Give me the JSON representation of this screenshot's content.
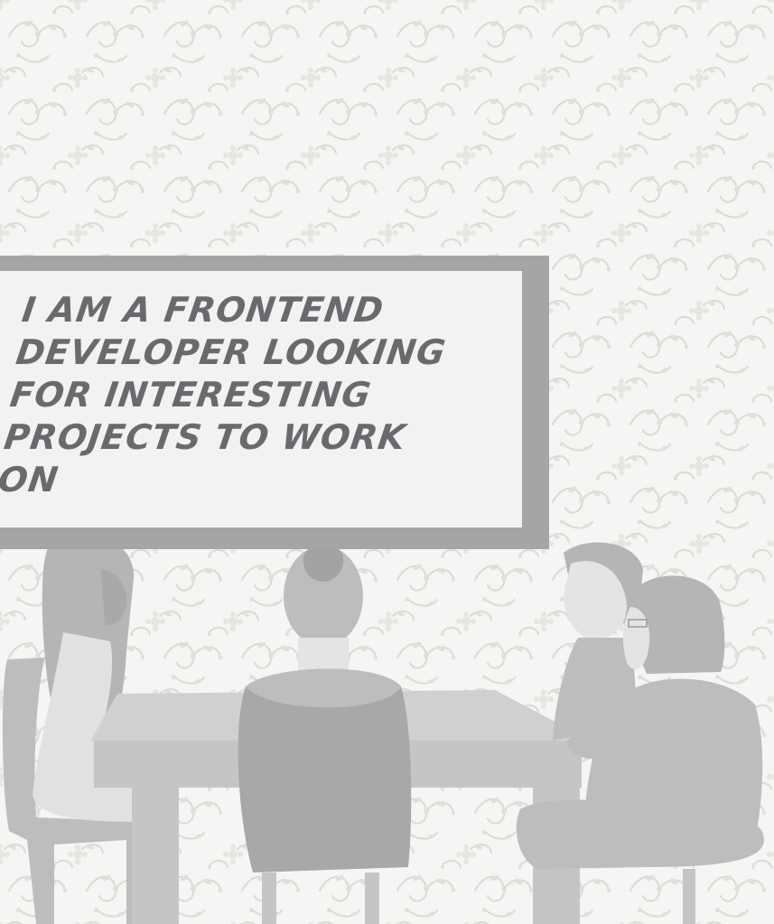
{
  "board": {
    "message": "I AM A FRONTEND\nDEVELOPER LOOKING\nFOR INTERESTING\nPROJECTS TO WORK\nON"
  },
  "colors": {
    "wall": "#f6f5f3",
    "wallpaper_pattern": "#dddcd8",
    "board_frame": "#a5a5a8",
    "board_surface": "#f2f2f2",
    "board_text": "#6a6a6e",
    "table": "#cdcdcf",
    "figures_light": "#bdbdbf",
    "figures_dark": "#a8a8ab",
    "skin": "#e4e4e6"
  },
  "icons": {
    "wallpaper": "floral-damask-pattern",
    "scene": "meeting-table-people-illustration"
  }
}
